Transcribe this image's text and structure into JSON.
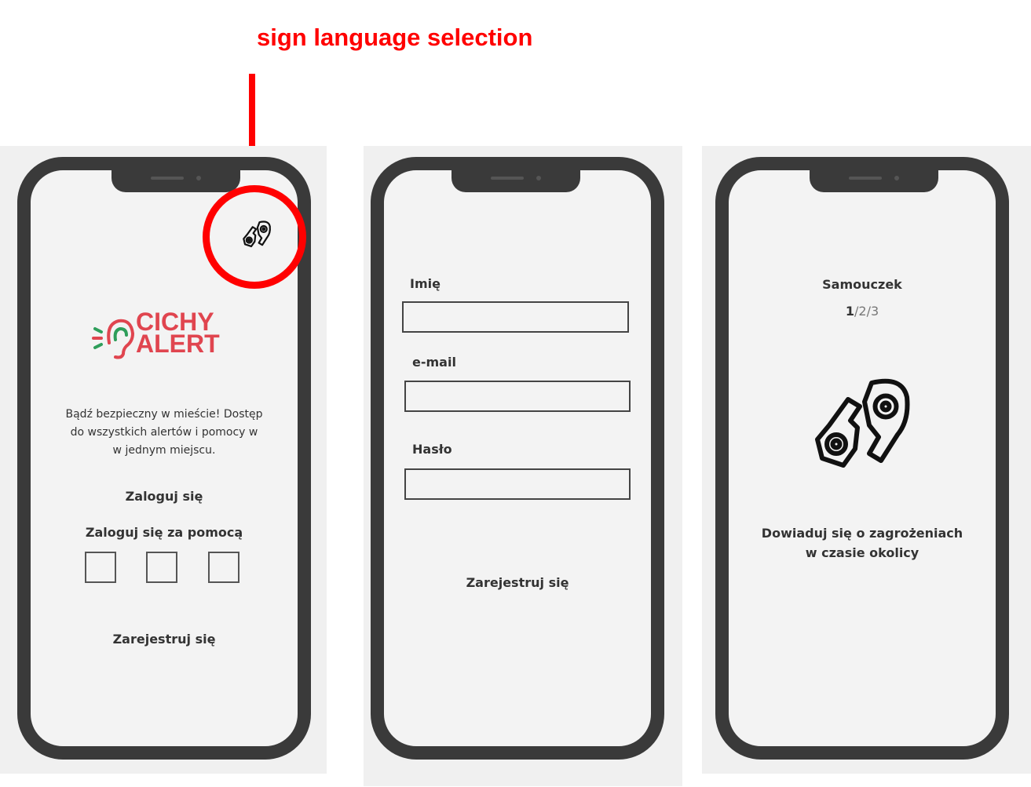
{
  "annotation": {
    "label": "sign language selection",
    "color": "#ff0000"
  },
  "screen1": {
    "sign_language_icon": "sign-language-icon",
    "logo": {
      "line1": "CICHY",
      "line2": "ALERT",
      "brand_color": "#e0454f",
      "accent_color": "#2e9e5a"
    },
    "tagline_line1": "Bądź bezpieczny w mieście! Dostęp",
    "tagline_line2": "do wszystkich alertów i pomocy w",
    "tagline_line3": "w jednym miejscu.",
    "login_label": "Zaloguj się",
    "login_with_label": "Zaloguj się za pomocą",
    "register_label": "Zarejestruj się"
  },
  "screen2": {
    "name_label": "Imię",
    "email_label": "e-mail",
    "password_label": "Hasło",
    "name_value": "",
    "email_value": "",
    "password_value": "",
    "register_label": "Zarejestruj się"
  },
  "screen3": {
    "title": "Samouczek",
    "step_current": "1",
    "step_rest": "/2/3",
    "sign_language_icon": "sign-language-icon",
    "desc_line1": "Dowiaduj się o zagrożeniach",
    "desc_line2": "w czasie okolicy"
  }
}
